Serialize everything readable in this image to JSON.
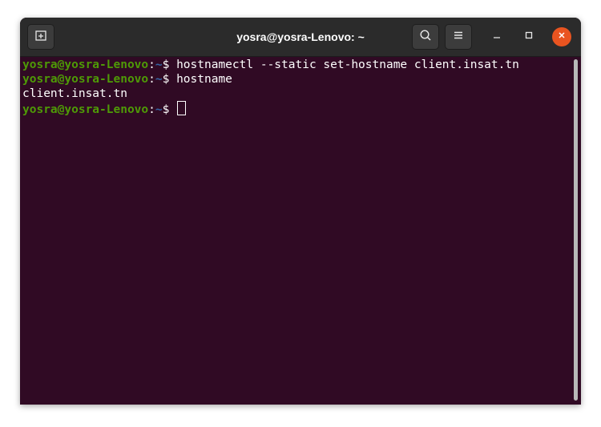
{
  "window": {
    "title": "yosra@yosra-Lenovo: ~"
  },
  "toolbar": {
    "new_tab_icon": "new-tab-icon",
    "search_icon": "search-icon",
    "menu_icon": "hamburger-menu-icon",
    "minimize_icon": "minimize-icon",
    "maximize_icon": "maximize-icon",
    "close_icon": "close-icon"
  },
  "colors": {
    "terminal_bg": "#300a24",
    "prompt_user": "#4e9a06",
    "prompt_path": "#3465a4",
    "close_button": "#e95420",
    "titlebar": "#2b2b2b"
  },
  "terminal": {
    "lines": [
      {
        "user": "yosra@yosra-Lenovo",
        "sep": ":",
        "path": "~",
        "dollar": "$ ",
        "cmd": "hostnamectl --static set-hostname client.insat.tn"
      },
      {
        "user": "yosra@yosra-Lenovo",
        "sep": ":",
        "path": "~",
        "dollar": "$ ",
        "cmd": "hostname"
      },
      {
        "output": "client.insat.tn"
      },
      {
        "user": "yosra@yosra-Lenovo",
        "sep": ":",
        "path": "~",
        "dollar": "$ ",
        "cmd": ""
      }
    ]
  }
}
